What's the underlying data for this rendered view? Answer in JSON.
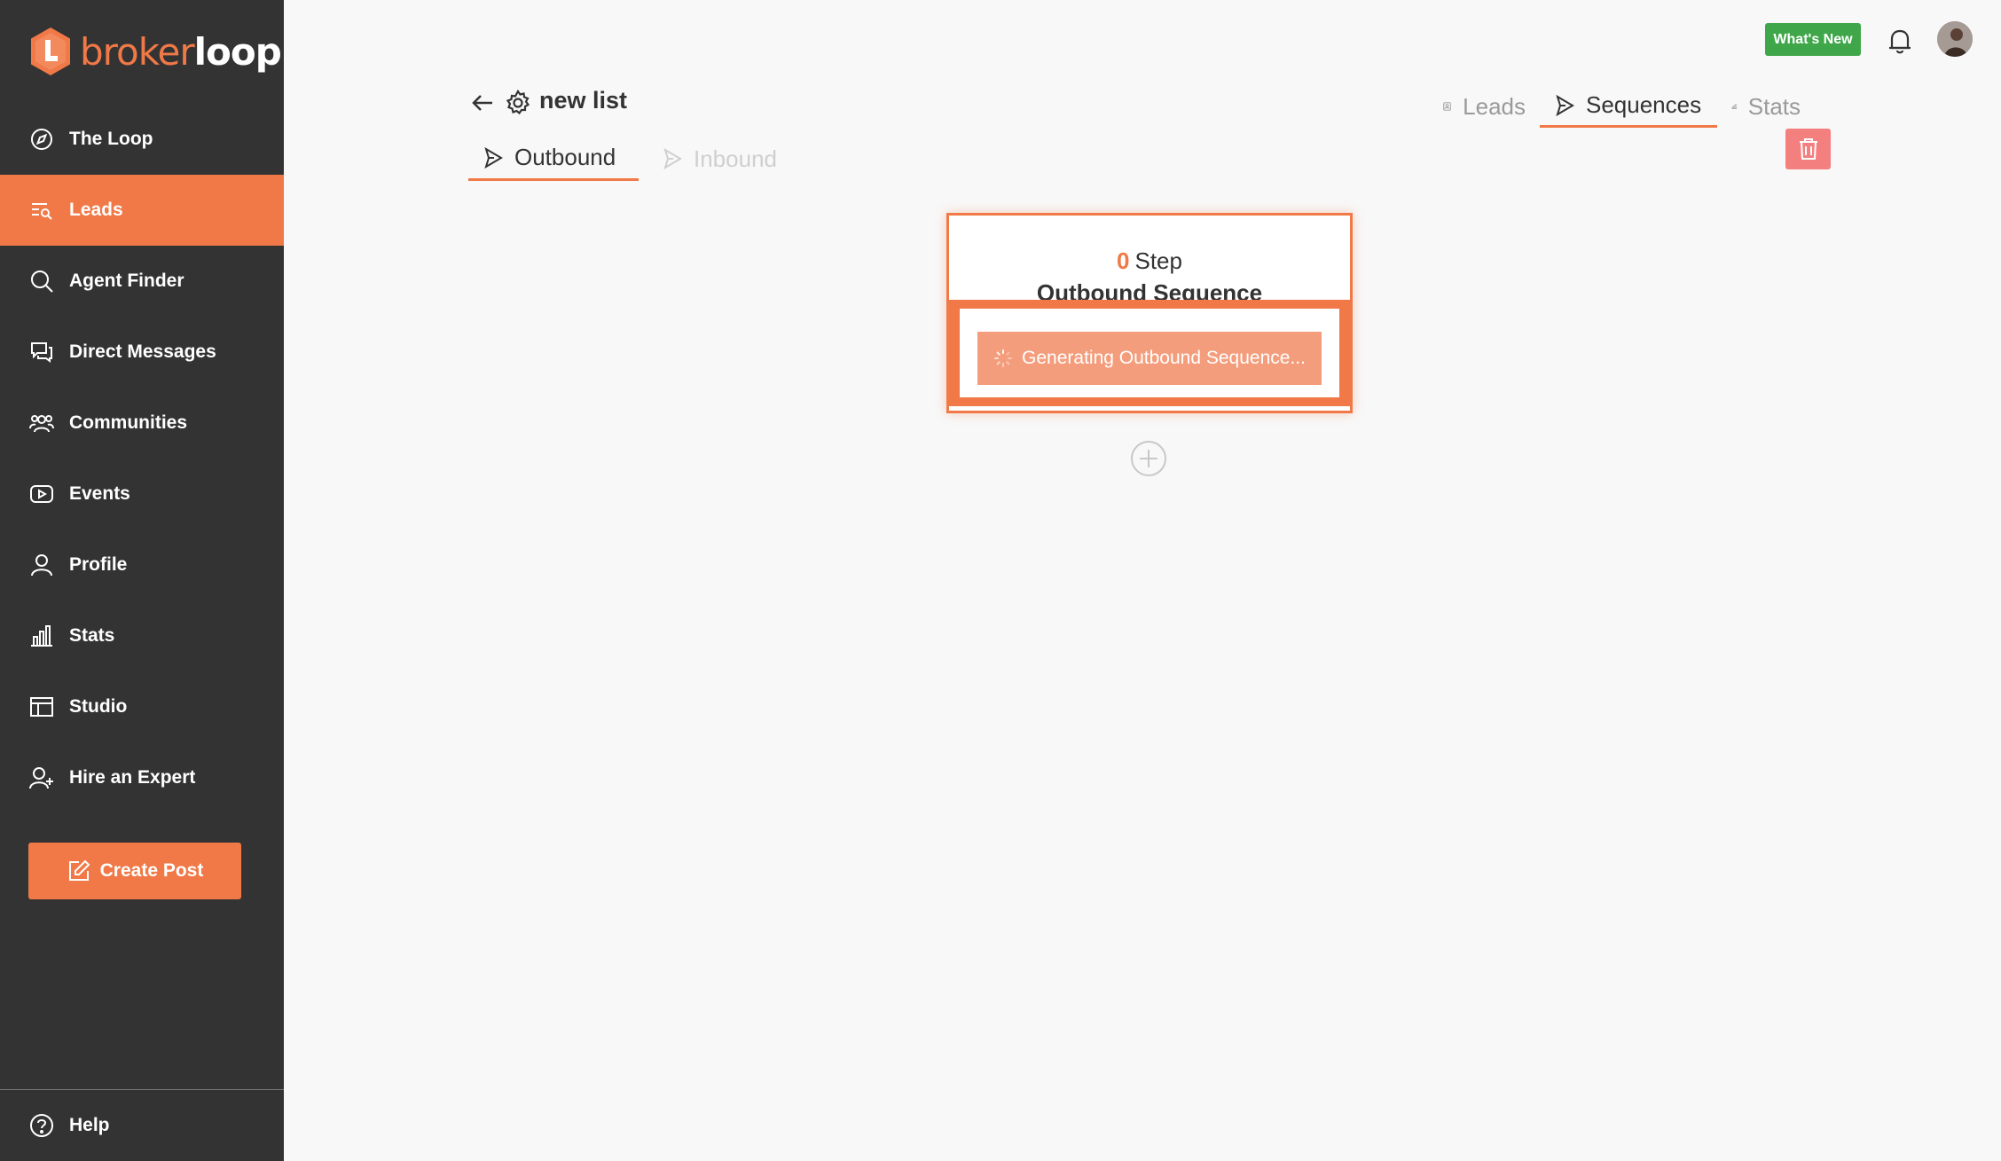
{
  "app": {
    "logo_broker": "broker",
    "logo_loop": "loop"
  },
  "sidebar": {
    "items": [
      {
        "label": "The Loop",
        "icon": "compass-icon"
      },
      {
        "label": "Leads",
        "icon": "leads-search-icon",
        "active": true
      },
      {
        "label": "Agent Finder",
        "icon": "search-icon"
      },
      {
        "label": "Direct Messages",
        "icon": "messages-icon"
      },
      {
        "label": "Communities",
        "icon": "people-icon"
      },
      {
        "label": "Events",
        "icon": "video-play-icon"
      },
      {
        "label": "Profile",
        "icon": "user-icon"
      },
      {
        "label": "Stats",
        "icon": "bar-chart-icon"
      },
      {
        "label": "Studio",
        "icon": "layout-icon"
      },
      {
        "label": "Hire an Expert",
        "icon": "user-plus-icon"
      }
    ],
    "create_post_label": "Create Post",
    "help_label": "Help"
  },
  "header": {
    "whats_new_label": "What's New"
  },
  "page": {
    "title": "new list",
    "top_tabs": [
      {
        "label": "Leads",
        "icon": "contact-book-icon"
      },
      {
        "label": "Sequences",
        "icon": "send-icon",
        "active": true
      },
      {
        "label": "Stats",
        "icon": "bar-chart-icon"
      }
    ],
    "sub_tabs": [
      {
        "label": "Outbound",
        "icon": "send-icon",
        "active": true
      },
      {
        "label": "Inbound",
        "icon": "send-icon",
        "disabled": true
      }
    ]
  },
  "sequence": {
    "step_count": "0",
    "step_label": "Step",
    "name": "Outbound Sequence",
    "generating_label": "Generating Outbound Sequence..."
  },
  "colors": {
    "accent": "#f07947",
    "sidebar_bg": "#333333",
    "whats_new": "#3fa74a",
    "delete": "#f47f7f"
  }
}
